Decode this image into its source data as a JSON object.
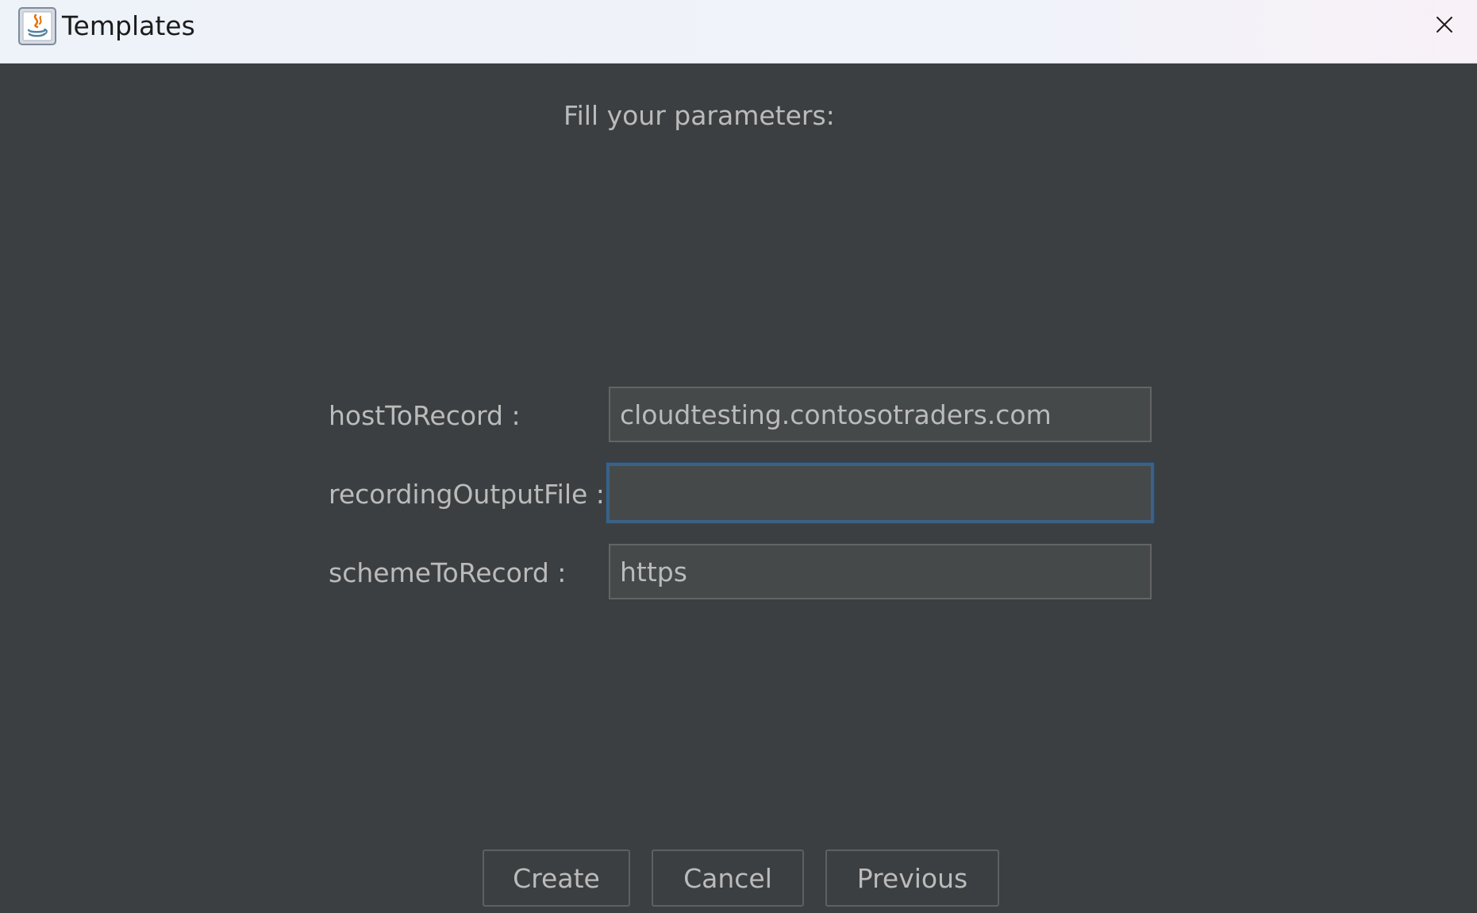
{
  "window": {
    "title": "Templates",
    "icon": "java-app-icon",
    "close_icon": "close-icon"
  },
  "form": {
    "heading": "Fill your parameters:",
    "fields": [
      {
        "label": "hostToRecord :",
        "value": "cloudtesting.contosotraders.com"
      },
      {
        "label": "recordingOutputFile :",
        "value": ""
      },
      {
        "label": "schemeToRecord :",
        "value": "https"
      }
    ]
  },
  "buttons": {
    "create": "Create",
    "cancel": "Cancel",
    "previous": "Previous"
  },
  "colors": {
    "background": "#3c3f41",
    "text": "#bbbbbb",
    "input_bg": "#45494a",
    "focus_border": "#3d6185"
  }
}
